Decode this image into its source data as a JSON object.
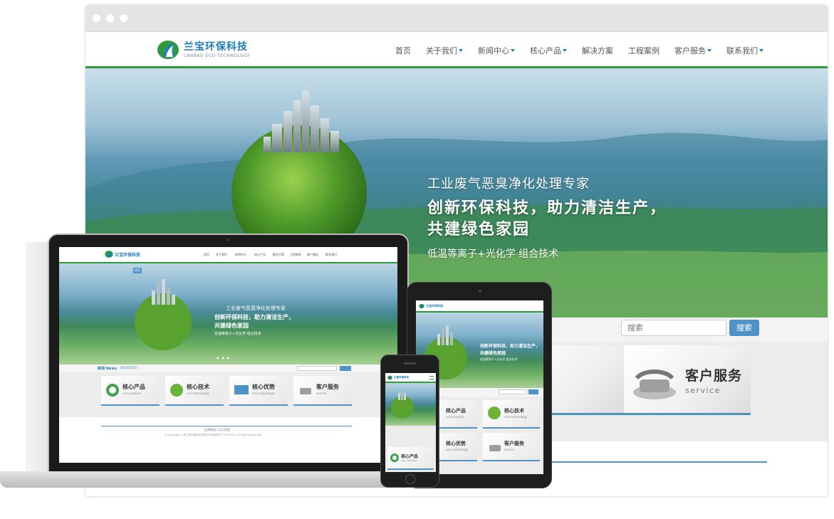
{
  "logo": {
    "name": "兰宝环保科技",
    "tagline": "LANBAO ECO TECHNOLOGY"
  },
  "nav": {
    "items": [
      {
        "label": "首页",
        "dropdown": false
      },
      {
        "label": "关于我们",
        "dropdown": true
      },
      {
        "label": "新闻中心",
        "dropdown": true
      },
      {
        "label": "核心产品",
        "dropdown": true
      },
      {
        "label": "解决方案",
        "dropdown": false
      },
      {
        "label": "工程案例",
        "dropdown": false
      },
      {
        "label": "客户服务",
        "dropdown": true
      },
      {
        "label": "联系我们",
        "dropdown": true
      }
    ]
  },
  "hero": {
    "line1": "工业废气恶臭净化处理专家",
    "line2a": "创新环保科技，助力清洁生产，",
    "line2b": "共建绿色家园",
    "line3": "低温等离子+光化学 组合技术"
  },
  "search": {
    "placeholder": "搜索",
    "button": "搜索"
  },
  "features": [
    {
      "title": "核心产品",
      "subtitle": "core product"
    },
    {
      "title": "核心技术",
      "subtitle": "core technology"
    },
    {
      "title": "核心优势",
      "subtitle": "core advantage"
    },
    {
      "title": "客户服务",
      "subtitle": "service"
    }
  ],
  "laptop": {
    "slide_tag": "首页",
    "news_label": "新闻 News",
    "news_item": "2015/12/25",
    "footer_links": "友情链接 | 站点地图",
    "copyright": "© Copyright 上海兰宝环保科技有限公司 版权所有 1999-2014. All Rights Reserved"
  },
  "colors": {
    "brand_blue": "#1c7fb5",
    "brand_green": "#2e9a3a",
    "button_blue": "#4f92c6"
  }
}
